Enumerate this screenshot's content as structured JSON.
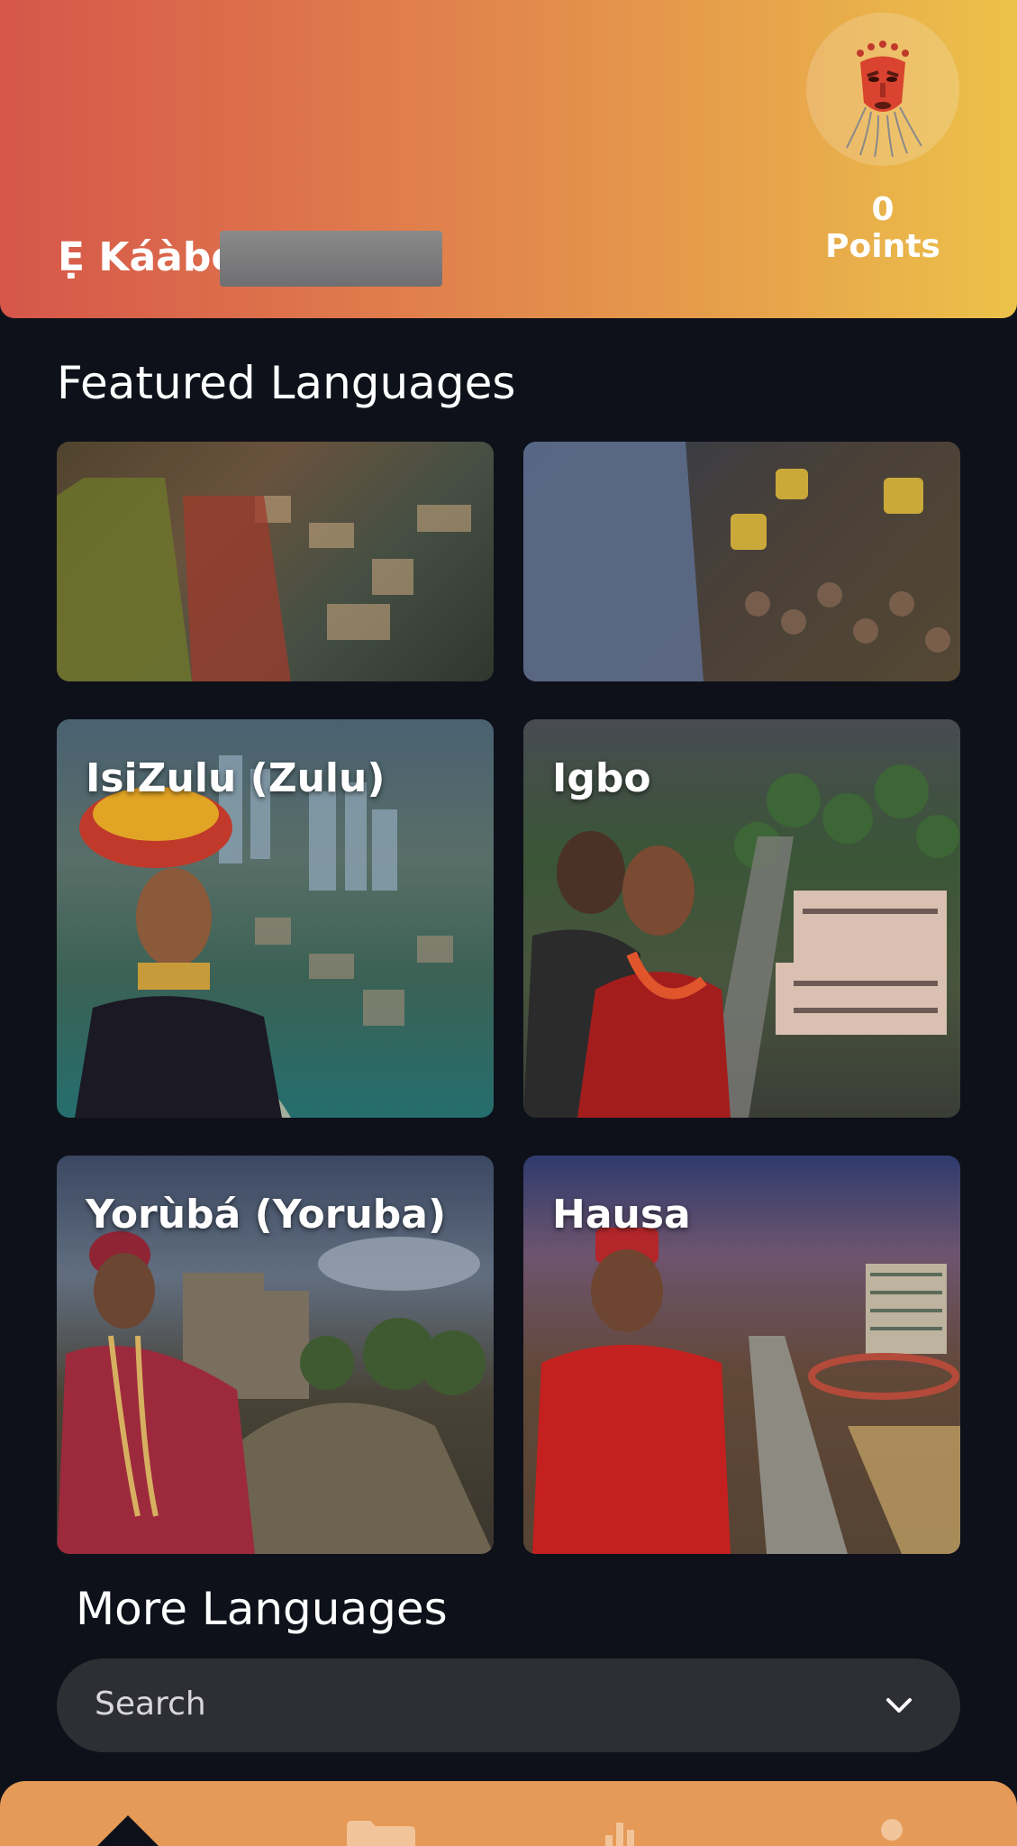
{
  "header": {
    "greeting": "Ẹ Káàbọ̀,",
    "points_label": "0 Points"
  },
  "featured": {
    "title": "Featured Languages",
    "cards": [
      {
        "label": ""
      },
      {
        "label": ""
      },
      {
        "label": "IsiZulu (Zulu)"
      },
      {
        "label": "Igbo"
      },
      {
        "label": "Yorùbá (Yoruba)"
      },
      {
        "label": "Hausa"
      }
    ]
  },
  "more": {
    "title": "More Languages",
    "search_placeholder": "Search"
  },
  "nav": {
    "icons": [
      "home-icon",
      "folder-icon",
      "chart-icon",
      "profile-icon"
    ]
  },
  "colors": {
    "header_start": "#d6564a",
    "header_end": "#ecc24a",
    "background": "#0e111a",
    "nav": "#e59a57"
  }
}
